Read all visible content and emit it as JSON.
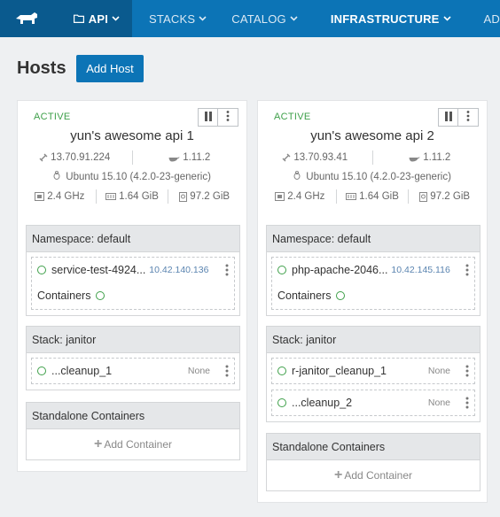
{
  "nav": {
    "logo_icon": "rancher-logo-icon",
    "env_label": "API",
    "items": [
      {
        "label": "STACKS"
      },
      {
        "label": "CATALOG"
      },
      {
        "label": "INFRASTRUCTURE"
      },
      {
        "label": "AD"
      }
    ]
  },
  "page": {
    "title": "Hosts",
    "add_host": "Add Host"
  },
  "hosts": [
    {
      "state": "ACTIVE",
      "name": "yun's awesome api 1",
      "ip": "13.70.91.224",
      "docker_version": "1.11.2",
      "os": "Ubuntu 15.10 (4.2.0-23-generic)",
      "cpu": "2.4 GHz",
      "memory": "1.64 GiB",
      "storage": "97.2 GiB",
      "namespace_title": "Namespace: default",
      "namespace_service": "service-test-4924...",
      "namespace_service_ip": "10.42.140.136",
      "containers_label": "Containers",
      "stack_title": "Stack: janitor",
      "stack_items": [
        {
          "name": "...cleanup_1",
          "value": "None"
        }
      ],
      "standalone_title": "Standalone Containers",
      "add_container": "Add Container"
    },
    {
      "state": "ACTIVE",
      "name": "yun's awesome api 2",
      "ip": "13.70.93.41",
      "docker_version": "1.11.2",
      "os": "Ubuntu 15.10 (4.2.0-23-generic)",
      "cpu": "2.4 GHz",
      "memory": "1.64 GiB",
      "storage": "97.2 GiB",
      "namespace_title": "Namespace: default",
      "namespace_service": "php-apache-2046...",
      "namespace_service_ip": "10.42.145.116",
      "containers_label": "Containers",
      "stack_title": "Stack: janitor",
      "stack_items": [
        {
          "name": "r-janitor_cleanup_1",
          "value": "None"
        },
        {
          "name": "...cleanup_2",
          "value": "None"
        }
      ],
      "standalone_title": "Standalone Containers",
      "add_container": "Add Container"
    }
  ],
  "colors": {
    "nav_bg": "#0c74b6",
    "nav_active_bg": "#0a5a8e",
    "active_state": "#3fa04a"
  }
}
